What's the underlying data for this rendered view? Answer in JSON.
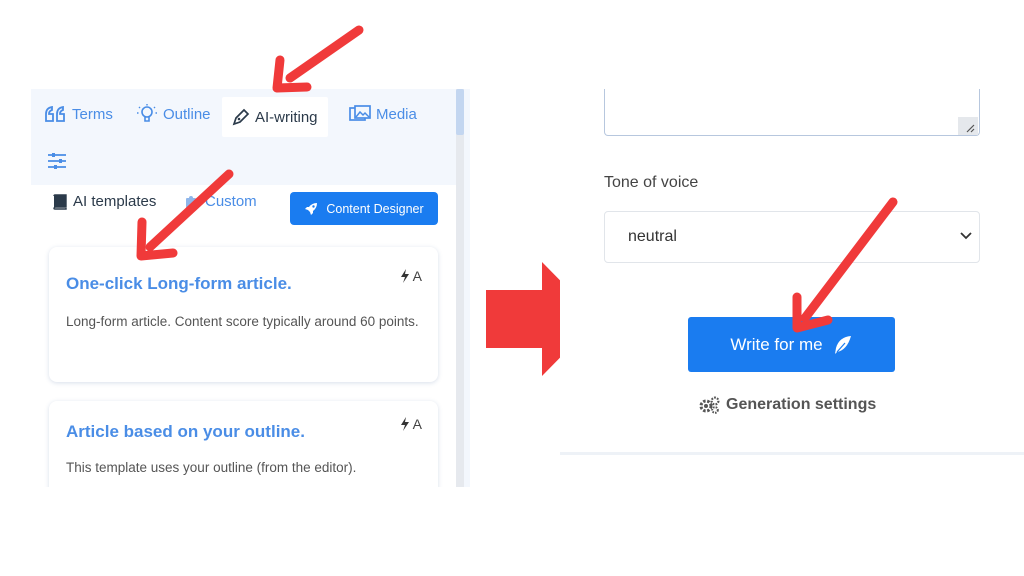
{
  "left_panel": {
    "tabs": [
      {
        "label": "Terms",
        "icon": "quote-icon"
      },
      {
        "label": "Outline",
        "icon": "lightbulb-icon"
      },
      {
        "label": "AI-writing",
        "icon": "pen-icon",
        "active": true
      },
      {
        "label": "Media",
        "icon": "image-icon"
      }
    ],
    "settings_icon": "sliders-icon",
    "subtabs": {
      "ai_templates": "AI templates",
      "custom": "Custom",
      "content_designer": "Content Designer"
    },
    "cards": [
      {
        "title": "One-click Long-form article.",
        "badge": "A",
        "description": "Long-form article. Content score typically around 60 points."
      },
      {
        "title": "Article based on your outline.",
        "badge": "A",
        "description": "This template uses your outline (from the editor)."
      }
    ]
  },
  "right_panel": {
    "tone_label": "Tone of voice",
    "tone_value": "neutral",
    "write_button": "Write for me",
    "generation_settings": "Generation settings"
  },
  "colors": {
    "accent": "#1a7cf0",
    "link": "#4a8de6",
    "annotation_red": "#f03a3a"
  }
}
